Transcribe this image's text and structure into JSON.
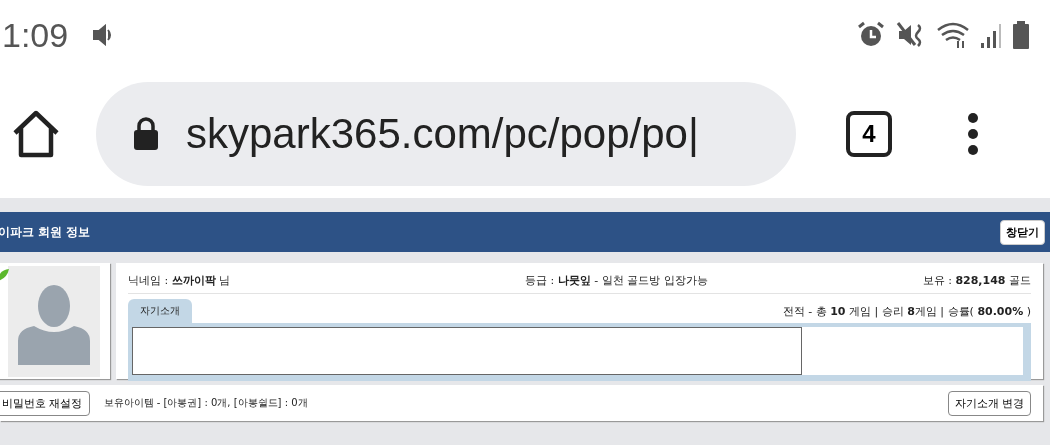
{
  "status_bar": {
    "time": "1:09"
  },
  "browser": {
    "url": "skypark365.com/pc/pop/po|",
    "tab_count": "4"
  },
  "popup": {
    "title": "이파크 회원 정보",
    "close_button": "창닫기",
    "nickname": "닉네임 : **쓰까이팍** 님",
    "grade": "등급 : **나뭇잎** - 일천 골드방 입장가능",
    "gold": "보유 : **828,148** 골드",
    "record": "전적 - 총 **10** 게임 | 승리 **8**게임 | 승률( **80.00%** )",
    "tabs": [
      {
        "label": "자기소개",
        "selected": true
      }
    ],
    "reset_password_button": "비밀번호 재설정",
    "items": "보유아이템 - [아봉권] : 0개, [아봉쉴드] : 0개",
    "edit_intro_button": "자기소개 변경"
  }
}
